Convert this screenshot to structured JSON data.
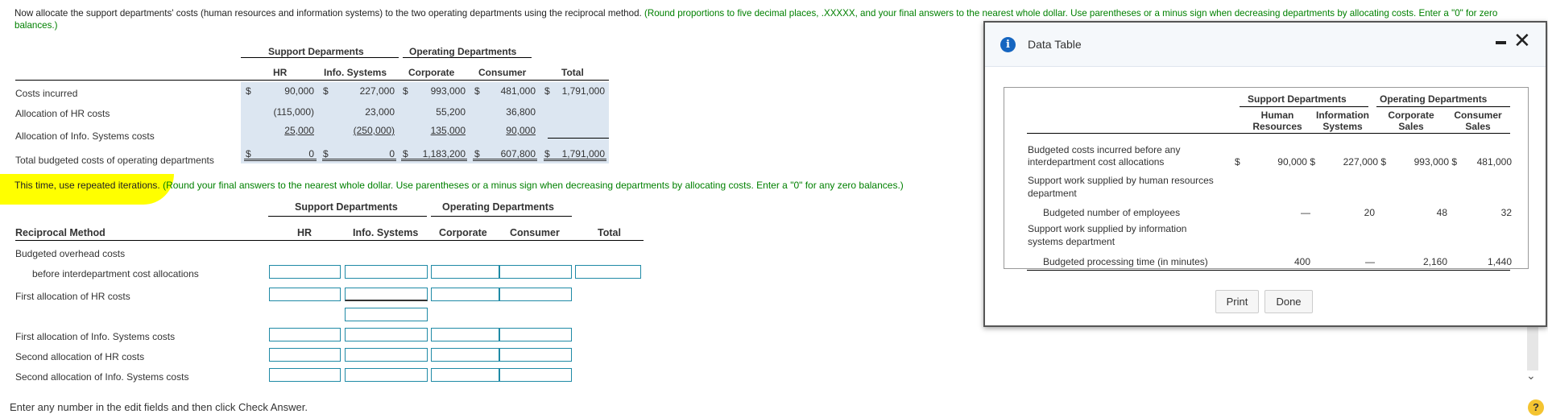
{
  "instructions": {
    "main": "Now allocate the support departments' costs (human resources and information systems) to the two operating departments using the reciprocal method.",
    "green": "(Round proportions to five decimal places, .XXXXX, and your final answers to the nearest whole dollar. Use parentheses or a minus sign when decreasing departments by allocating costs. Enter a \"0\" for zero balances.)"
  },
  "table1": {
    "group_support": "Support Deparments",
    "group_operating": "Operating Departments",
    "columns": [
      "HR",
      "Info. Systems",
      "Corporate",
      "Consumer",
      "Total"
    ],
    "rows": [
      {
        "label": "Costs incurred",
        "values": [
          "90,000",
          "227,000",
          "993,000",
          "481,000",
          "1,791,000"
        ]
      },
      {
        "label": "Allocation of HR costs",
        "values": [
          "(115,000)",
          "23,000",
          "55,200",
          "36,800",
          ""
        ]
      },
      {
        "label": "Allocation of Info. Systems costs",
        "values": [
          "25,000",
          "(250,000)",
          "135,000",
          "90,000",
          ""
        ]
      },
      {
        "label": "Total budgeted costs of operating departments",
        "values": [
          "0",
          "0",
          "1,183,200",
          "607,800",
          "1,791,000"
        ]
      }
    ],
    "dollar": "$"
  },
  "second_instr": {
    "highlight": "This time, use repeated iterations.",
    "green": " (Round your final answers to the nearest whole dollar. Use parentheses or a minus sign when decreasing departments by allocating costs. Enter a \"0\" for any zero balances.)"
  },
  "table2": {
    "group_support": "Support Departments",
    "group_operating": "Operating Departments",
    "title": "Reciprocal Method",
    "columns": [
      "HR",
      "Info. Systems",
      "Corporate",
      "Consumer",
      "Total"
    ],
    "row_labels": [
      "Budgeted overhead costs",
      "before interdepartment cost allocations",
      "First allocation of HR costs",
      "First allocation of Info. Systems costs",
      "Second allocation of HR costs",
      "Second allocation of Info. Systems costs"
    ]
  },
  "footer": "Enter any number in the edit fields and then click Check Answer.",
  "dialog": {
    "title": "Data Table",
    "group_support": "Support Departments",
    "group_operating": "Operating Departments",
    "col_heads": [
      [
        "Human",
        "Resources"
      ],
      [
        "Information",
        "Systems"
      ],
      [
        "Corporate",
        "Sales"
      ],
      [
        "Consumer",
        "Sales"
      ]
    ],
    "rows": [
      {
        "label1": "Budgeted costs incurred before any",
        "label2": "interdepartment cost allocations",
        "values": [
          "90,000 $",
          "227,000 $",
          "993,000 $",
          "481,000"
        ]
      },
      {
        "label1": "Support work supplied by human resources",
        "label2": "department"
      },
      {
        "label1": "Budgeted number of employees",
        "values": [
          "—",
          "20",
          "48",
          "32"
        ]
      },
      {
        "label1": "Support work supplied by information",
        "label2": "systems department"
      },
      {
        "label1": "Budgeted processing time (in minutes)",
        "values": [
          "400",
          "—",
          "2,160",
          "1,440"
        ]
      }
    ],
    "dollar": "$",
    "print": "Print",
    "done": "Done"
  },
  "help": "?"
}
